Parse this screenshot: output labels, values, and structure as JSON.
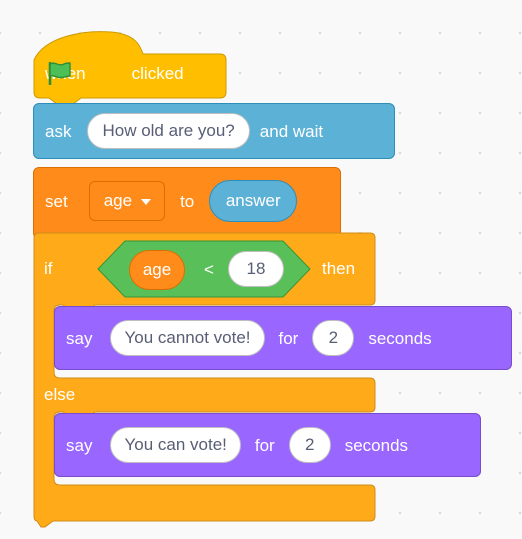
{
  "blocks": {
    "hat": {
      "when": "when",
      "flag_icon": "green-flag-icon",
      "clicked": "clicked"
    },
    "ask": {
      "keyword": "ask",
      "question": "How old are you?",
      "suffix": "and wait"
    },
    "set": {
      "keyword": "set",
      "variable": "age",
      "to": "to",
      "value": "answer"
    },
    "if_else": {
      "if": "if",
      "condition": {
        "left": "age",
        "operator": "<",
        "right": "18"
      },
      "then": "then",
      "else": "else"
    },
    "say1": {
      "keyword": "say",
      "message": "You cannot vote!",
      "for": "for",
      "secs": "2",
      "unit": "seconds"
    },
    "say2": {
      "keyword": "say",
      "message": "You can vote!",
      "for": "for",
      "secs": "2",
      "unit": "seconds"
    }
  },
  "colors": {
    "events": "#ffbf00",
    "sensing": "#5cb1d6",
    "variables": "#ff8c1a",
    "control": "#ffab19",
    "operators": "#59c059",
    "looks": "#9966ff",
    "flag": "#4cbf56"
  }
}
